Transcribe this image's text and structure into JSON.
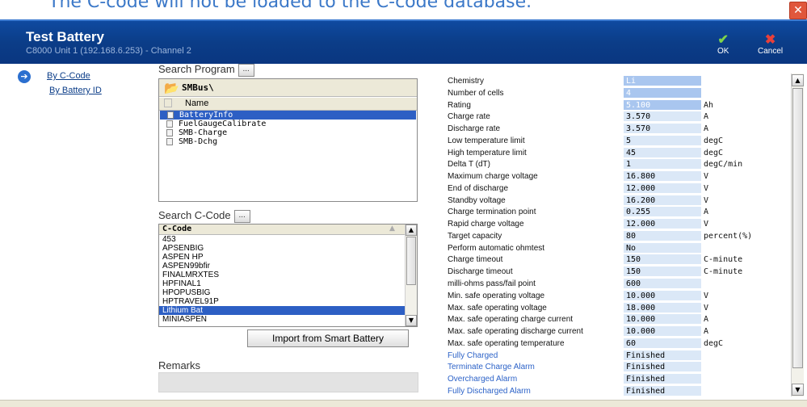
{
  "window": {
    "clipped_text": "The C-code will not be loaded to the C-code database.",
    "close_glyph": "✕",
    "title": "Test Battery",
    "subtitle": "C8000 Unit 1 (192.168.6.253) - Channel 2",
    "ok_label": "OK",
    "cancel_label": "Cancel",
    "ok_icon": "checkmark-icon",
    "cancel_icon": "x-icon"
  },
  "nav": {
    "items": [
      {
        "label": "By C-Code",
        "active": true
      },
      {
        "label": "By Battery ID",
        "active": false
      }
    ]
  },
  "program": {
    "header": "Search Program",
    "browse_label": "...",
    "path": "SMBus\\",
    "column": "Name",
    "items": [
      {
        "name": "BatteryInfo",
        "selected": true
      },
      {
        "name": "FuelGaugeCalibrate",
        "selected": false
      },
      {
        "name": "SMB-Charge",
        "selected": false
      },
      {
        "name": "SMB-Dchg",
        "selected": false
      }
    ]
  },
  "ccode": {
    "header": "Search C-Code",
    "browse_label": "...",
    "column": "C-Code",
    "items": [
      {
        "name": "453",
        "selected": false
      },
      {
        "name": "APSENBIG",
        "selected": false
      },
      {
        "name": "ASPEN HP",
        "selected": false
      },
      {
        "name": "ASPEN99bfir",
        "selected": false
      },
      {
        "name": "FINALMRXTES",
        "selected": false
      },
      {
        "name": "HPFINAL1",
        "selected": false
      },
      {
        "name": "HPOPUSBIG",
        "selected": false
      },
      {
        "name": "HPTRAVEL91P",
        "selected": false
      },
      {
        "name": "Lithium Bat",
        "selected": true
      },
      {
        "name": "MINIASPEN",
        "selected": false
      }
    ],
    "import_label": "Import from Smart Battery"
  },
  "remarks": {
    "label": "Remarks",
    "value": ""
  },
  "params": [
    {
      "label": "Chemistry",
      "value": "Li",
      "unit": "",
      "highlight": true,
      "alarm": false
    },
    {
      "label": "Number of cells",
      "value": "4",
      "unit": "",
      "highlight": true,
      "alarm": false
    },
    {
      "label": "Rating",
      "value": "5.100",
      "unit": "Ah",
      "highlight": true,
      "alarm": false
    },
    {
      "label": "Charge rate",
      "value": "3.570",
      "unit": "A",
      "highlight": false,
      "alarm": false
    },
    {
      "label": "Discharge rate",
      "value": "3.570",
      "unit": "A",
      "highlight": false,
      "alarm": false
    },
    {
      "label": "Low temperature limit",
      "value": "5",
      "unit": "degC",
      "highlight": false,
      "alarm": false
    },
    {
      "label": "High temperature limit",
      "value": "45",
      "unit": "degC",
      "highlight": false,
      "alarm": false
    },
    {
      "label": "Delta T (dT)",
      "value": "1",
      "unit": "degC/min",
      "highlight": false,
      "alarm": false
    },
    {
      "label": "Maximum charge voltage",
      "value": "16.800",
      "unit": "V",
      "highlight": false,
      "alarm": false
    },
    {
      "label": "End of discharge",
      "value": "12.000",
      "unit": "V",
      "highlight": false,
      "alarm": false
    },
    {
      "label": "Standby voltage",
      "value": "16.200",
      "unit": "V",
      "highlight": false,
      "alarm": false
    },
    {
      "label": "Charge termination point",
      "value": "0.255",
      "unit": "A",
      "highlight": false,
      "alarm": false
    },
    {
      "label": "Rapid charge voltage",
      "value": "12.000",
      "unit": "V",
      "highlight": false,
      "alarm": false
    },
    {
      "label": "Target capacity",
      "value": "80",
      "unit": "percent(%)",
      "highlight": false,
      "alarm": false
    },
    {
      "label": "Perform automatic ohmtest",
      "value": "No",
      "unit": "",
      "highlight": false,
      "alarm": false
    },
    {
      "label": "Charge timeout",
      "value": "150",
      "unit": "C-minute",
      "highlight": false,
      "alarm": false
    },
    {
      "label": "Discharge timeout",
      "value": "150",
      "unit": "C-minute",
      "highlight": false,
      "alarm": false
    },
    {
      "label": "milli-ohms pass/fail point",
      "value": "600",
      "unit": "",
      "highlight": false,
      "alarm": false
    },
    {
      "label": "Min. safe operating voltage",
      "value": "10.000",
      "unit": "V",
      "highlight": false,
      "alarm": false
    },
    {
      "label": "Max. safe operating voltage",
      "value": "18.000",
      "unit": "V",
      "highlight": false,
      "alarm": false
    },
    {
      "label": "Max. safe operating charge current",
      "value": "10.000",
      "unit": "A",
      "highlight": false,
      "alarm": false
    },
    {
      "label": "Max. safe operating discharge current",
      "value": "10.000",
      "unit": "A",
      "highlight": false,
      "alarm": false
    },
    {
      "label": "Max. safe operating temperature",
      "value": "60",
      "unit": "degC",
      "highlight": false,
      "alarm": false
    },
    {
      "label": "Fully Charged",
      "value": "Finished",
      "unit": "",
      "highlight": false,
      "alarm": true
    },
    {
      "label": "Terminate Charge Alarm",
      "value": "Finished",
      "unit": "",
      "highlight": false,
      "alarm": true
    },
    {
      "label": "Overcharged Alarm",
      "value": "Finished",
      "unit": "",
      "highlight": false,
      "alarm": true
    },
    {
      "label": "Fully Discharged Alarm",
      "value": "Finished",
      "unit": "",
      "highlight": false,
      "alarm": true
    }
  ],
  "colors": {
    "header_bg": "#0b3d88",
    "selection": "#2d5fc4",
    "value_cell": "#dbe8f7",
    "alarm_label": "#2d63c8"
  }
}
